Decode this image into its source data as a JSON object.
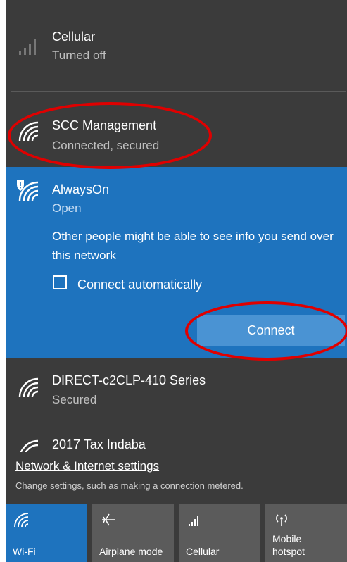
{
  "networks": {
    "cellular": {
      "name": "Cellular",
      "status": "Turned off"
    },
    "scc": {
      "name": "SCC Management",
      "status": "Connected, secured"
    },
    "alwayson": {
      "name": "AlwaysOn",
      "status": "Open",
      "warning": "Other people might be able to see info you send over this network",
      "auto_connect_label": "Connect automatically",
      "auto_connect_checked": false,
      "connect_label": "Connect"
    },
    "direct": {
      "name": "DIRECT-c2CLP-410 Series",
      "status": "Secured"
    },
    "tax": {
      "name": "2017 Tax Indaba"
    }
  },
  "settings": {
    "link": "Network & Internet settings",
    "description": "Change settings, such as making a connection metered."
  },
  "quick_actions": [
    {
      "label": "Wi-Fi",
      "icon": "wifi-icon",
      "active": true
    },
    {
      "label": "Airplane mode",
      "icon": "airplane-icon",
      "active": false
    },
    {
      "label": "Cellular",
      "icon": "cellular-icon",
      "active": false
    },
    {
      "label": "Mobile hotspot",
      "icon": "hotspot-icon",
      "active": false
    }
  ],
  "colors": {
    "panel": "#3b3b3b",
    "accent": "#1e73be",
    "callout": "#e00000",
    "tile": "#5b5b5b"
  }
}
